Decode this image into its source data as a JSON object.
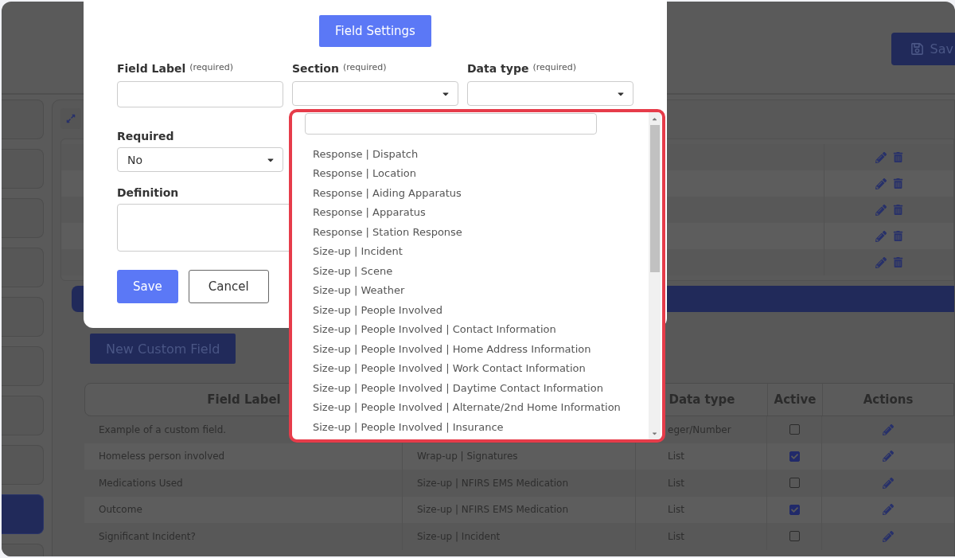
{
  "page": {
    "save_button": "Sav",
    "sidebar": {
      "items": [
        {
          "selected": false
        },
        {
          "selected": false
        },
        {
          "selected": false
        },
        {
          "selected": false
        },
        {
          "selected": false
        },
        {
          "selected": false
        },
        {
          "selected": false
        },
        {
          "selected": false
        },
        {
          "selected": true
        },
        {
          "selected": false
        }
      ]
    },
    "upper_rows": [
      {
        "kind": "editable"
      },
      {
        "kind": "editable"
      },
      {
        "kind": "editable"
      },
      {
        "kind": "editable"
      },
      {
        "kind": "editable"
      }
    ],
    "new_field_button": "New Custom Field",
    "table": {
      "headings": {
        "label": "Field Label",
        "data_type": "Data type",
        "active": "Active",
        "actions": "Actions"
      },
      "rows": [
        {
          "label": "Example of a custom field.",
          "data_type": "eger/Number",
          "active": false
        },
        {
          "label": "Homeless person involved",
          "section": "Wrap-up | Signatures",
          "data_type": "List",
          "active": true
        },
        {
          "label": "Medications Used",
          "section": "Size-up | NFIRS EMS Medication",
          "data_type": "List",
          "active": false
        },
        {
          "label": "Outcome",
          "section": "Size-up | NFIRS EMS Medication",
          "data_type": "List",
          "active": true
        },
        {
          "label": "Significant Incident?",
          "section": "Size-up | Incident",
          "data_type": "List",
          "active": false
        }
      ]
    }
  },
  "modal": {
    "title_button": "Field Settings",
    "fields": [
      {
        "label": "Field Label",
        "hint": "(required)",
        "kind": "text"
      },
      {
        "label": "Section",
        "hint": "(required)",
        "kind": "select"
      },
      {
        "label": "Data type",
        "hint": "(required)",
        "kind": "select"
      }
    ],
    "required": {
      "label": "Required",
      "value": "No"
    },
    "definition": {
      "label": "Definition"
    },
    "buttons": [
      {
        "label": "Save",
        "kind": "primary"
      },
      {
        "label": "Cancel",
        "kind": "secondary"
      }
    ]
  },
  "section_dropdown": {
    "options": [
      "Response | Dispatch",
      "Response | Location",
      "Response | Aiding Apparatus",
      "Response | Apparatus",
      "Response | Station Response",
      "Size-up | Incident",
      "Size-up | Scene",
      "Size-up | Weather",
      "Size-up | People Involved",
      "Size-up | People Involved | Contact Information",
      "Size-up | People Involved | Home Address Information",
      "Size-up | People Involved | Work Contact Information",
      "Size-up | People Involved | Daytime Contact Information",
      "Size-up | People Involved | Alternate/2nd Home Information",
      "Size-up | People Involved | Insurance"
    ]
  }
}
